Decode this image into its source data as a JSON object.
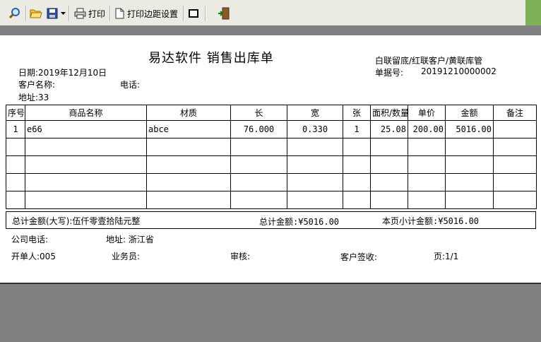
{
  "toolbar": {
    "print_label": "打印",
    "margin_label": "打印边距设置"
  },
  "doc": {
    "title": "易达软件 销售出库单",
    "subtitle": "白联留底/红联客户/黄联库管",
    "date": "日期:2019年12月10日",
    "order_label": "单据号:",
    "order_no": "20191210000002",
    "customer_label": "客户名称:",
    "phone_label": "电话:",
    "address": "地址:33"
  },
  "table": {
    "headers": [
      "序号",
      "商品名称",
      "材质",
      "长",
      "宽",
      "张",
      "面积/数量",
      "单价",
      "金额",
      "备注"
    ],
    "rows": [
      [
        "1",
        "e66",
        "abce",
        "76.000",
        "0.330",
        "1",
        "25.08",
        "200.00",
        "5016.00",
        ""
      ],
      [
        "",
        "",
        "",
        "",
        "",
        "",
        "",
        "",
        "",
        ""
      ],
      [
        "",
        "",
        "",
        "",
        "",
        "",
        "",
        "",
        "",
        ""
      ],
      [
        "",
        "",
        "",
        "",
        "",
        "",
        "",
        "",
        "",
        ""
      ],
      [
        "",
        "",
        "",
        "",
        "",
        "",
        "",
        "",
        "",
        ""
      ]
    ]
  },
  "totals": {
    "uppercase": "总计金额(大写):伍仟零壹拾陆元整",
    "total": "总计金额:¥5016.00",
    "page_subtotal": "本页小计金额:¥5016.00"
  },
  "footer": {
    "company_phone": "公司电话:",
    "company_address": "地址: 浙江省",
    "issuer": "开单人:005",
    "salesperson": "业务员:",
    "reviewer": "审核:",
    "customer_sign": "客户签收:",
    "page": "页:1/1"
  }
}
